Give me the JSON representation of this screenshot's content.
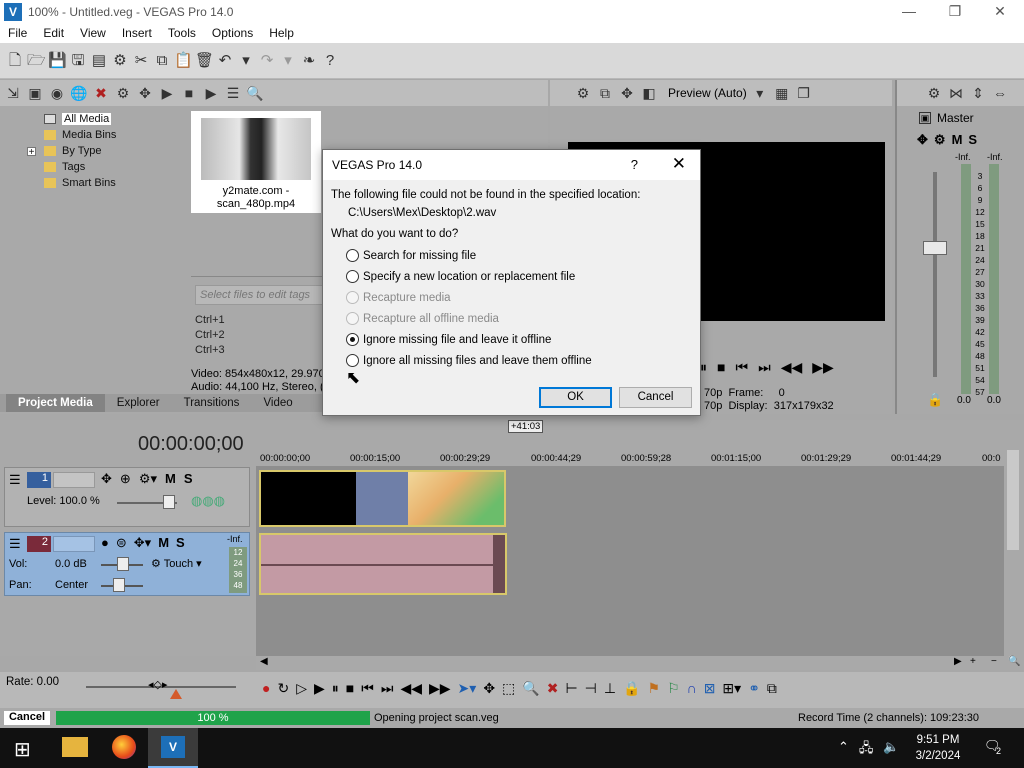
{
  "window": {
    "title": "100% - Untitled.veg - VEGAS Pro 14.0",
    "min": "—",
    "max": "❐",
    "close": "✕"
  },
  "menu": [
    "File",
    "Edit",
    "View",
    "Insert",
    "Tools",
    "Options",
    "Help"
  ],
  "media": {
    "tree": [
      "All Media",
      "Media Bins",
      "By Type",
      "Tags",
      "Smart Bins"
    ],
    "expander": "+",
    "thumb_label": "y2mate.com - scan_480p.mp4",
    "tags_placeholder": "Select files to edit tags",
    "shortcuts": [
      "Ctrl+1",
      "Ctrl+2",
      "Ctrl+3"
    ],
    "video_info": "Video: 854x480x12, 29.970",
    "audio_info": "Audio: 44,100 Hz, Stereo, (",
    "tabs": [
      "Project Media",
      "Explorer",
      "Transitions",
      "Video"
    ]
  },
  "preview": {
    "mode": "Preview (Auto)",
    "frame_label": "Frame:",
    "frame_val": "0",
    "display_label": "Display:",
    "display_val": "317x179x32",
    "res1": "70p",
    "res2": "70p"
  },
  "master": {
    "title": "Master",
    "inf_l": "-Inf.",
    "inf_r": "-Inf.",
    "scale": [
      "3",
      "6",
      "9",
      "12",
      "15",
      "18",
      "21",
      "24",
      "27",
      "30",
      "33",
      "36",
      "39",
      "42",
      "45",
      "48",
      "51",
      "54",
      "57"
    ],
    "val_l": "0.0",
    "val_r": "0.0"
  },
  "dialog": {
    "title": "VEGAS Pro 14.0",
    "help": "?",
    "close": "✕",
    "msg": "The following file could not be found in the specified location:",
    "path": "C:\\Users\\Mex\\Desktop\\2.wav",
    "question": "What do you want to do?",
    "options": [
      {
        "label": "Search for missing file",
        "disabled": false,
        "checked": false
      },
      {
        "label": "Specify a new location or replacement file",
        "disabled": false,
        "checked": false
      },
      {
        "label": "Recapture media",
        "disabled": true,
        "checked": false
      },
      {
        "label": "Recapture all offline media",
        "disabled": true,
        "checked": false
      },
      {
        "label": "Ignore missing file and leave it offline",
        "disabled": false,
        "checked": true
      },
      {
        "label": "Ignore all missing files and leave them offline",
        "disabled": false,
        "checked": false
      }
    ],
    "ok": "OK",
    "cancel": "Cancel"
  },
  "timeline": {
    "timecode": "00:00:00;00",
    "marker": "+41:03",
    "ruler": [
      "00:00:00;00",
      "00:00:15;00",
      "00:00:29;29",
      "00:00:44;29",
      "00:00:59;28",
      "00:01:15;00",
      "00:01:29;29",
      "00:01:44;29",
      "00:0"
    ],
    "track1": {
      "num": "1",
      "level": "Level: 100.0 %",
      "m": "M",
      "s": "S"
    },
    "track2": {
      "num": "2",
      "vol_label": "Vol:",
      "vol": "0.0 dB",
      "pan_label": "Pan:",
      "pan": "Center",
      "touch": "Touch",
      "m": "M",
      "s": "S",
      "inf": "-Inf.",
      "meter": [
        "12",
        "24",
        "36",
        "48"
      ]
    },
    "rate": "Rate: 0.00"
  },
  "status": {
    "cancel": "Cancel",
    "progress": "100 %",
    "progress_value": 100,
    "message": "Opening project scan.veg",
    "record": "Record Time (2 channels): 109:23:30"
  },
  "taskbar": {
    "time": "9:51 PM",
    "date": "3/2/2024",
    "notif": "2"
  }
}
